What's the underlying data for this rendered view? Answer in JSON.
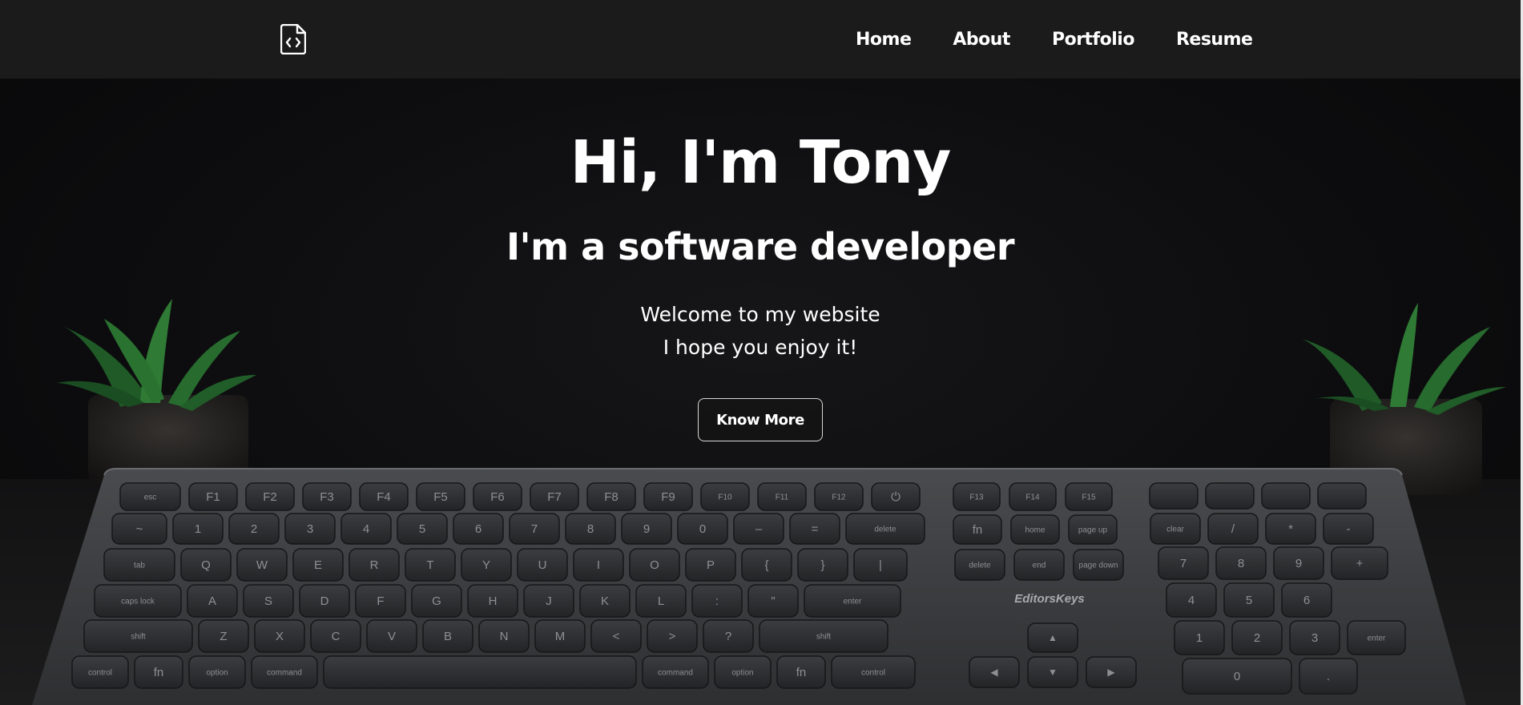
{
  "nav": {
    "logo_icon": "code-file-icon",
    "links": [
      {
        "label": "Home"
      },
      {
        "label": "About"
      },
      {
        "label": "Portfolio"
      },
      {
        "label": "Resume"
      }
    ]
  },
  "hero": {
    "title": "Hi, I'm Tony",
    "subtitle": "I'm a software developer",
    "line1": "Welcome to my website",
    "line2": "I hope you enjoy it!",
    "button_label": "Know More",
    "background": "keyboard-with-plants-photo",
    "brand": "EditorsKeys"
  },
  "keys": {
    "fn_row": [
      "esc",
      "F1",
      "F2",
      "F3",
      "F4",
      "F5",
      "F6",
      "F7",
      "F8",
      "F9",
      "F10",
      "F11",
      "F12",
      "⏻"
    ],
    "num_row": [
      "~",
      "1",
      "2",
      "3",
      "4",
      "5",
      "6",
      "7",
      "8",
      "9",
      "0",
      "–",
      "=",
      "delete"
    ],
    "top_row": [
      "tab",
      "Q",
      "W",
      "E",
      "R",
      "T",
      "Y",
      "U",
      "I",
      "O",
      "P",
      "{",
      "}",
      "|"
    ],
    "home_row": [
      "caps lock",
      "A",
      "S",
      "D",
      "F",
      "G",
      "H",
      "J",
      "K",
      "L",
      ":",
      "\"",
      "enter"
    ],
    "bottom_row": [
      "shift",
      "Z",
      "X",
      "C",
      "V",
      "B",
      "N",
      "M",
      "<",
      ">",
      "?",
      "shift"
    ],
    "space_row": [
      "control",
      "fn",
      "option",
      "command",
      "",
      "command",
      "option",
      "fn",
      "control"
    ],
    "mid_top": [
      "F13",
      "F14",
      "F15"
    ],
    "mid_row1": [
      "fn",
      "home",
      "page up"
    ],
    "mid_row2": [
      "delete",
      "end",
      "page down"
    ],
    "numpad_row1": [
      "clear",
      "/",
      "*",
      "-"
    ],
    "numpad_row2": [
      "7",
      "8",
      "9",
      "+"
    ],
    "numpad_row3": [
      "4",
      "5",
      "6"
    ],
    "numpad_row4": [
      "1",
      "2",
      "3",
      "enter"
    ],
    "numpad_row5": [
      "0",
      "."
    ]
  },
  "colors": {
    "nav_bg": "#1c1b1b",
    "hero_bg": "#0d0d0f",
    "keyboard_body": "#3a3b3d",
    "key": "#2a2b2d",
    "plant": "#2f7a35"
  }
}
